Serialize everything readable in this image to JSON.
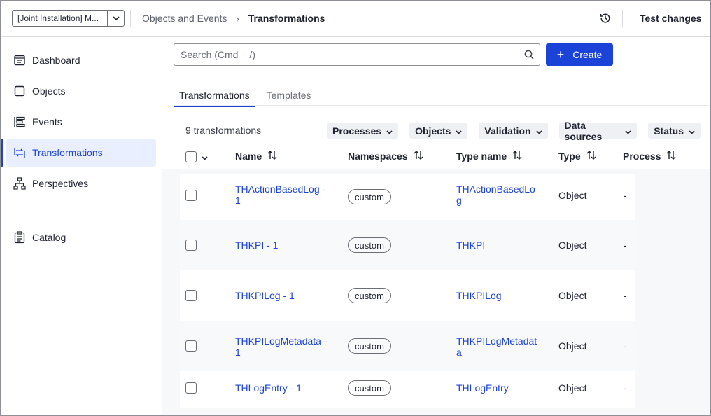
{
  "header": {
    "environment": "[Joint Installation] M...",
    "breadcrumb": {
      "parent": "Objects and Events",
      "separator": "›",
      "current": "Transformations"
    },
    "test_changes_label": "Test changes"
  },
  "sidebar": {
    "items": [
      {
        "label": "Dashboard",
        "icon": "dashboard-icon"
      },
      {
        "label": "Objects",
        "icon": "objects-icon"
      },
      {
        "label": "Events",
        "icon": "events-icon"
      },
      {
        "label": "Transformations",
        "icon": "transformations-icon",
        "active": true
      },
      {
        "label": "Perspectives",
        "icon": "perspectives-icon"
      },
      {
        "label": "Catalog",
        "icon": "catalog-icon"
      }
    ]
  },
  "toolbar": {
    "search_placeholder": "Search (Cmd + /)",
    "create_label": "Create"
  },
  "tabs": [
    {
      "label": "Transformations",
      "active": true
    },
    {
      "label": "Templates",
      "active": false
    }
  ],
  "list": {
    "count_label": "9 transformations",
    "filters": [
      "Processes",
      "Objects",
      "Validation",
      "Data sources",
      "Status"
    ]
  },
  "table": {
    "columns": [
      "Name",
      "Namespaces",
      "Type name",
      "Type",
      "Process"
    ],
    "rows": [
      {
        "name_line1": "THActionBasedLog -",
        "name_line2": "1",
        "namespace": "custom",
        "type_name_line1": "THActionBasedLo",
        "type_name_line2": "g",
        "type": "Object",
        "process": "-"
      },
      {
        "name_line1": "THKPI - 1",
        "name_line2": "",
        "namespace": "custom",
        "type_name_line1": "THKPI",
        "type_name_line2": "",
        "type": "Object",
        "process": "-"
      },
      {
        "name_line1": "THKPILog - 1",
        "name_line2": "",
        "namespace": "custom",
        "type_name_line1": "THKPILog",
        "type_name_line2": "",
        "type": "Object",
        "process": "-"
      },
      {
        "name_line1": "THKPILogMetadata -",
        "name_line2": "1",
        "namespace": "custom",
        "type_name_line1": "THKPILogMetadat",
        "type_name_line2": "a",
        "type": "Object",
        "process": "-"
      },
      {
        "name_line1": "THLogEntry - 1",
        "name_line2": "",
        "namespace": "custom",
        "type_name_line1": "THLogEntry",
        "type_name_line2": "",
        "type": "Object",
        "process": "-"
      }
    ]
  },
  "colors": {
    "accent": "#1c43d8",
    "active_bg": "#e9efff",
    "border": "#d9dbe0"
  }
}
